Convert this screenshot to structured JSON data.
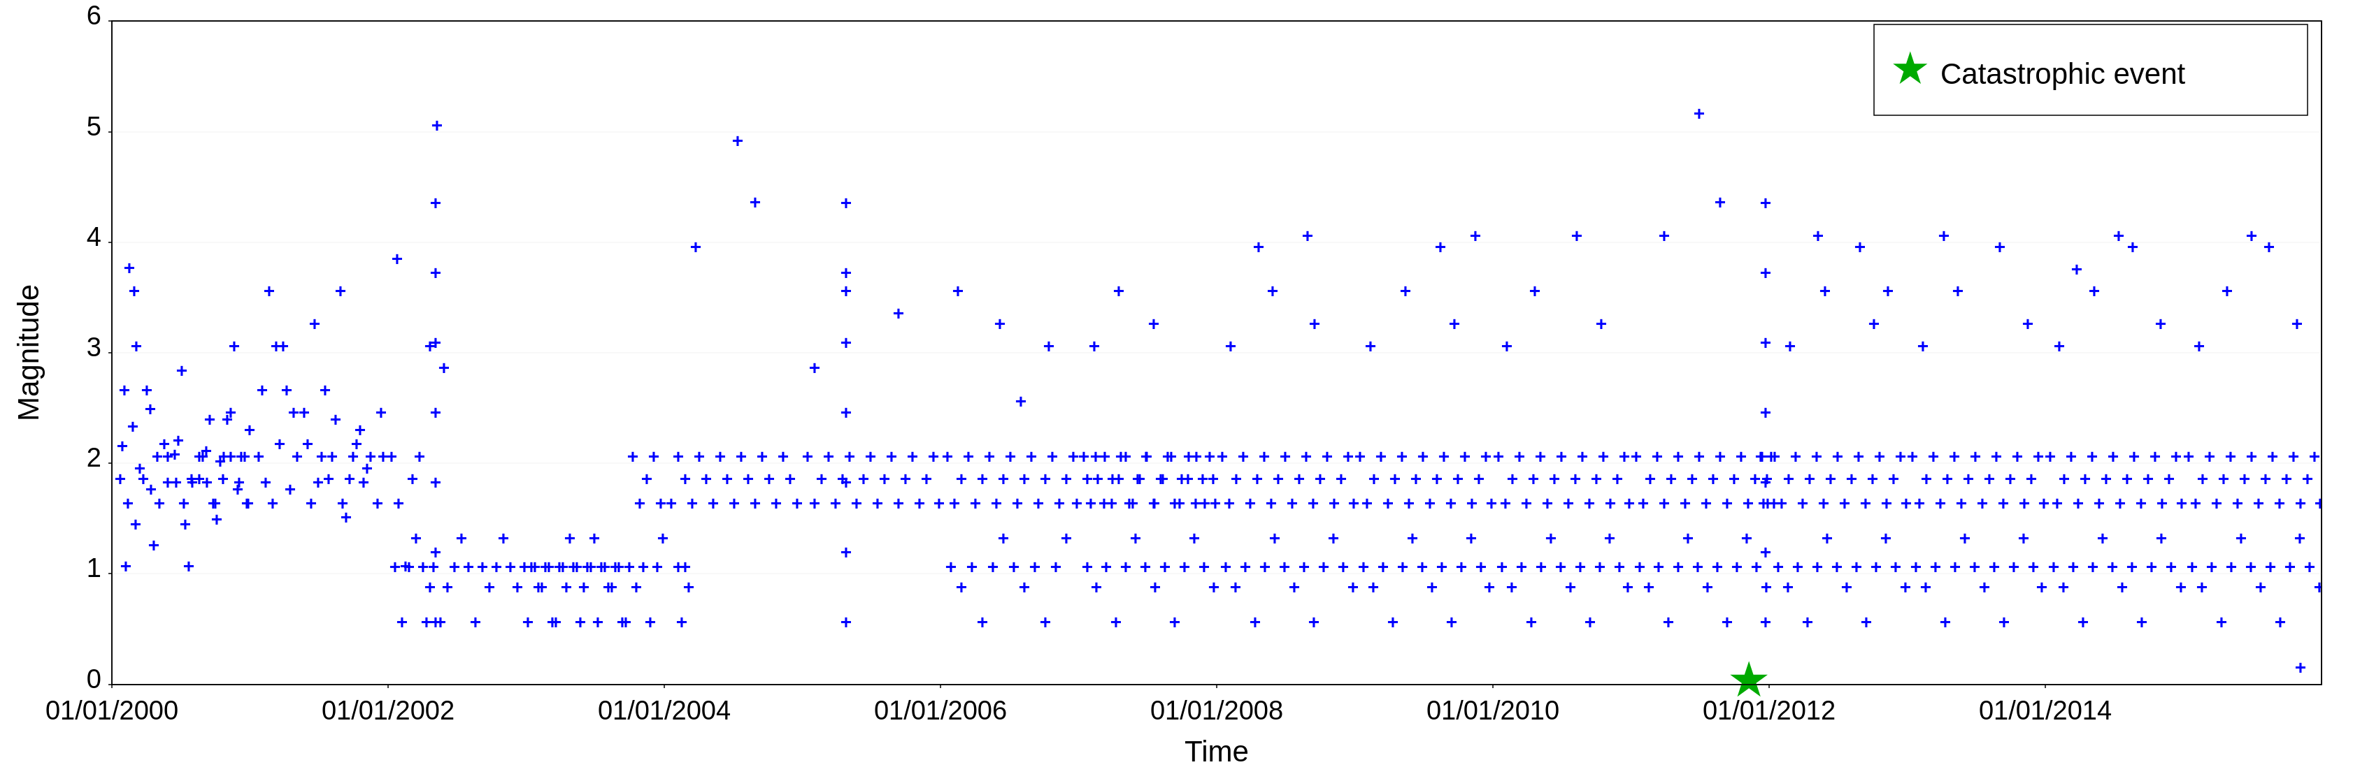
{
  "chart": {
    "title": "",
    "x_axis_label": "Time",
    "y_axis_label": "Magnitude",
    "x_ticks": [
      "01/01/2000",
      "01/01/2002",
      "01/01/2004",
      "01/01/2006",
      "01/01/2008",
      "01/01/2010",
      "01/01/2012",
      "01/01/2014"
    ],
    "y_ticks": [
      "0",
      "1",
      "2",
      "3",
      "4",
      "5",
      "6"
    ],
    "legend": {
      "marker": "star",
      "color": "#00aa00",
      "label": "Catastrophic event"
    },
    "accent_color": "#0000ff",
    "border_color": "#000000",
    "background_color": "#ffffff"
  }
}
